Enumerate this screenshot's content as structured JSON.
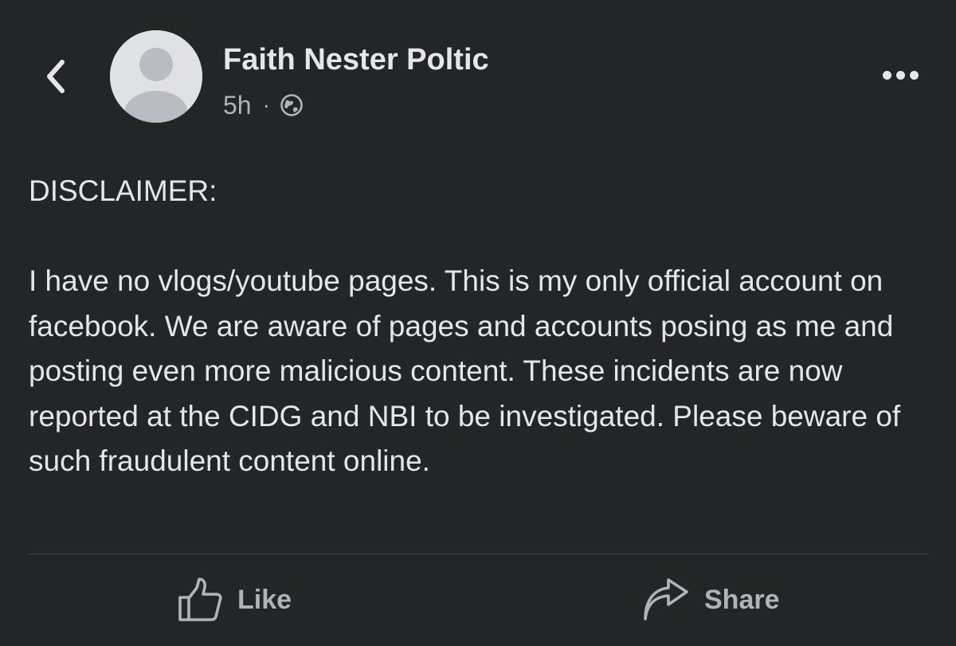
{
  "post": {
    "author_name": "Faith Nester Poltic",
    "time_ago": "5h",
    "separator": "·",
    "privacy_icon": "globe-icon",
    "heading": "DISCLAIMER:",
    "body": "I have no vlogs/youtube pages. This is my only official account on facebook. We are aware of pages and accounts posing as me and posting even more malicious content. These incidents are now reported at the CIDG and NBI to be investigated. Please beware of such fraudulent content online."
  },
  "nav": {
    "back_icon": "chevron-left-icon",
    "more_icon": "more-horizontal-icon"
  },
  "actions": {
    "like_label": "Like",
    "like_icon": "thumbs-up-icon",
    "share_label": "Share",
    "share_icon": "share-arrow-icon"
  },
  "colors": {
    "background": "#242526",
    "primary_text": "#e4e6eb",
    "secondary_text": "#b0b3b8",
    "divider": "#3e4042",
    "avatar_placeholder": "#dfe1e5"
  }
}
